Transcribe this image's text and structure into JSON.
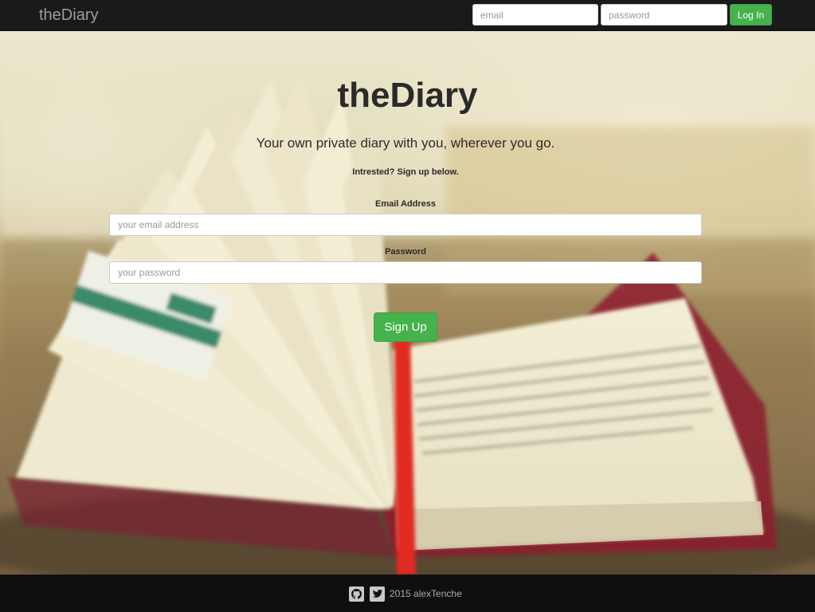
{
  "navbar": {
    "brand": "theDiary",
    "email_placeholder": "email",
    "password_placeholder": "password",
    "login_label": "Log In"
  },
  "hero": {
    "title": "theDiary",
    "tagline": "Your own private diary with you, wherever you go.",
    "signup_note": "Intrested? Sign up below."
  },
  "form": {
    "email_label": "Email Address",
    "email_placeholder": "your email address",
    "password_label": "Password",
    "password_placeholder": "your password",
    "signup_label": "Sign Up"
  },
  "footer": {
    "icons": [
      "github-icon",
      "twitter-icon"
    ],
    "credit": "2015 alexTenche"
  },
  "colors": {
    "navbar_bg": "#1a1a1a",
    "footer_bg": "#0f0f0f",
    "accent_green": "#45b24c",
    "title_text": "#2a2a2a"
  }
}
